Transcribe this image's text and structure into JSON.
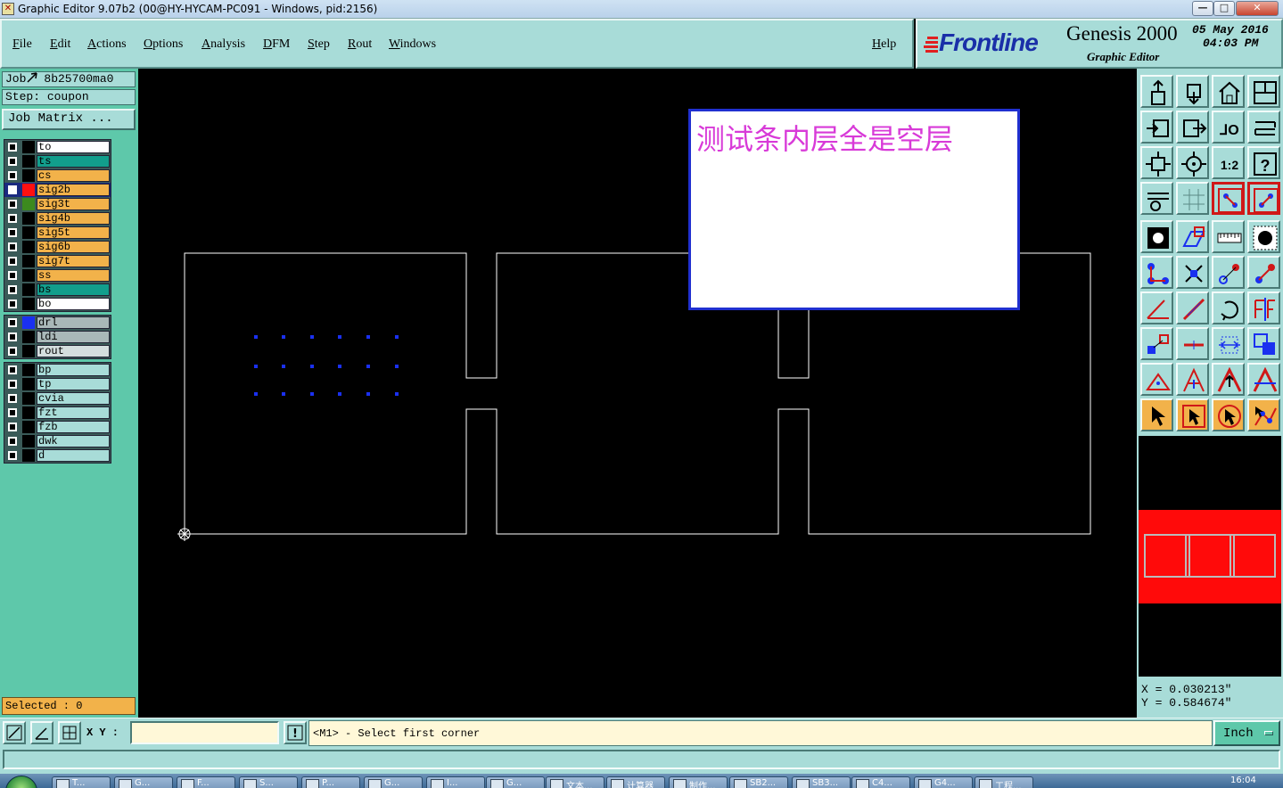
{
  "window": {
    "title": "Graphic Editor 9.07b2 (00@HY-HYCAM-PC091 - Windows, pid:2156)",
    "min_label": "—",
    "max_label": "□",
    "close_label": "✕"
  },
  "menu": {
    "items": [
      "File",
      "Edit",
      "Actions",
      "Options",
      "Analysis",
      "DFM",
      "Step",
      "Rout",
      "Windows"
    ],
    "help": "Help"
  },
  "brand": {
    "logo": "Frontline",
    "product": "Genesis 2000",
    "subtitle": "Graphic Editor",
    "date": "05 May 2016",
    "time": "04:03 PM",
    "logo_color": "#1a2fa8",
    "stripe_color": "#e02020"
  },
  "job": {
    "job_label": "Job",
    "job_name": "8b25700ma0",
    "step_label": "Step:",
    "step_name": "coupon",
    "matrix_button": "Job Matrix ..."
  },
  "layers": {
    "group1": [
      {
        "name": "to",
        "color": "#ffffff",
        "swatch": "#000000"
      },
      {
        "name": "ts",
        "color": "#129e8c",
        "swatch": "#000000"
      },
      {
        "name": "cs",
        "color": "#f2b24a",
        "swatch": "#000000"
      },
      {
        "name": "sig2b",
        "color": "#f2b24a",
        "swatch": "#ff1010",
        "active": true
      },
      {
        "name": "sig3t",
        "color": "#f2b24a",
        "swatch": "#3c8a1e"
      },
      {
        "name": "sig4b",
        "color": "#f2b24a",
        "swatch": "#000000"
      },
      {
        "name": "sig5t",
        "color": "#f2b24a",
        "swatch": "#000000"
      },
      {
        "name": "sig6b",
        "color": "#f2b24a",
        "swatch": "#000000"
      },
      {
        "name": "sig7t",
        "color": "#f2b24a",
        "swatch": "#000000"
      },
      {
        "name": "ss",
        "color": "#f2b24a",
        "swatch": "#000000"
      },
      {
        "name": "bs",
        "color": "#129e8c",
        "swatch": "#000000"
      },
      {
        "name": "bo",
        "color": "#ffffff",
        "swatch": "#000000"
      }
    ],
    "group2": [
      {
        "name": "drl",
        "color": "#a9b8b8",
        "swatch": "#1a30f0"
      },
      {
        "name": "ldi",
        "color": "#a9b8b8",
        "swatch": "#000000"
      },
      {
        "name": "rout",
        "color": "#d4dede",
        "swatch": "#000000"
      }
    ],
    "group3": [
      {
        "name": "bp",
        "color": "#a8dcd8",
        "swatch": "#000000"
      },
      {
        "name": "tp",
        "color": "#a8dcd8",
        "swatch": "#000000"
      },
      {
        "name": "cvia",
        "color": "#a8dcd8",
        "swatch": "#000000"
      },
      {
        "name": "fzt",
        "color": "#a8dcd8",
        "swatch": "#000000"
      },
      {
        "name": "fzb",
        "color": "#a8dcd8",
        "swatch": "#000000"
      },
      {
        "name": "dwk",
        "color": "#a8dcd8",
        "swatch": "#000000"
      },
      {
        "name": "d",
        "color": "#a8dcd8",
        "swatch": "#000000"
      }
    ]
  },
  "selected": "Selected : 0",
  "canvas": {
    "notice_text": "测试条内层全是空层",
    "notice_color": "#d83ad8",
    "outline_color": "#ffffff",
    "drill_color": "#1a30f0"
  },
  "coords": {
    "x_label": "X =",
    "x_value": "0.030213\"",
    "y_label": "Y =",
    "y_value": "0.584674\""
  },
  "bottom": {
    "xy_label": "X Y :",
    "xy_value": "",
    "exclaim": "!",
    "prompt": "<M1> - Select first corner",
    "units": "Inch"
  },
  "taskbar": {
    "tasks": [
      "T...",
      "G...",
      "F...",
      "S...",
      "P...",
      "G...",
      "I...",
      "G...",
      "文本...",
      "计算器",
      "制作...",
      "SB2...",
      "SB3...",
      "C4...",
      "G4...",
      "工程..."
    ],
    "clock": "16:04"
  },
  "tools": [
    "save-icon",
    "open-icon",
    "home-icon",
    "window-icon",
    "step-in-icon",
    "step-out-icon",
    "mirror-icon",
    "snap-icon",
    "fit-icon",
    "zoom-center-icon",
    "zoom-1to2-icon",
    "help-icon",
    "settings-icon",
    "grid-icon",
    "layers-red-icon",
    "layers-swap-icon",
    "pad-icon",
    "surface-icon",
    "measure-icon",
    "circle-icon",
    "connect-icon",
    "cross-icon",
    "line-red-icon",
    "line-blue-icon",
    "angle-icon",
    "diagonal-icon",
    "rotate-icon",
    "pad-split-icon",
    "move-icon",
    "minus-icon",
    "resize-icon",
    "group-icon",
    "triangle-small-icon",
    "triangle-icon",
    "triangle-arrow-icon",
    "triangle-cross-icon",
    "pointer-icon",
    "select-box-icon",
    "select-circle-icon",
    "select-path-icon"
  ]
}
